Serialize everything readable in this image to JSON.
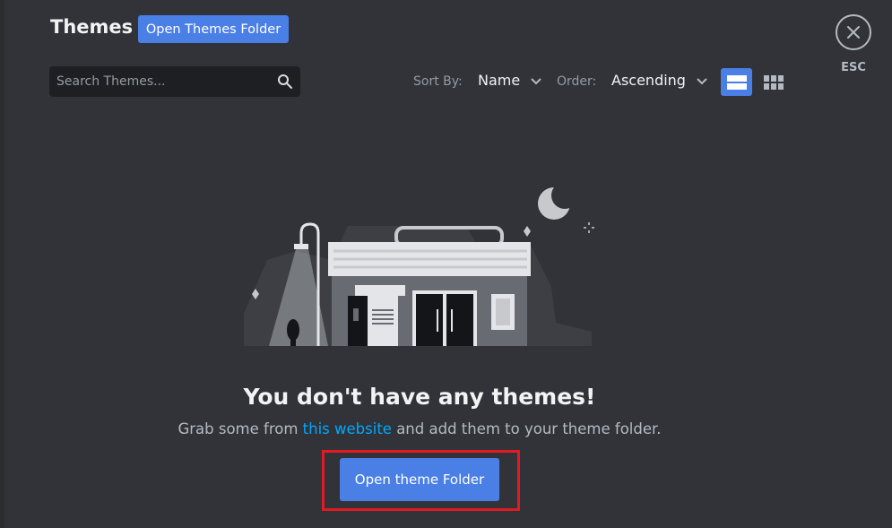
{
  "header": {
    "title": "Themes",
    "open_folder_label": "Open Themes Folder",
    "esc_label": "ESC"
  },
  "search": {
    "placeholder": "Search Themes..."
  },
  "sort": {
    "sort_by_label": "Sort By:",
    "sort_by_value": "Name",
    "order_label": "Order:",
    "order_value": "Ascending"
  },
  "view_modes": {
    "active": "list"
  },
  "empty_state": {
    "title": "You don't have any themes!",
    "subtitle_before": "Grab some from ",
    "subtitle_link": "this website",
    "subtitle_after": " and add them to your theme folder.",
    "button_label": "Open theme Folder"
  },
  "colors": {
    "background": "#313338",
    "accent": "#4a7fe6",
    "link": "#00a8fc",
    "highlight": "#e21b23"
  }
}
